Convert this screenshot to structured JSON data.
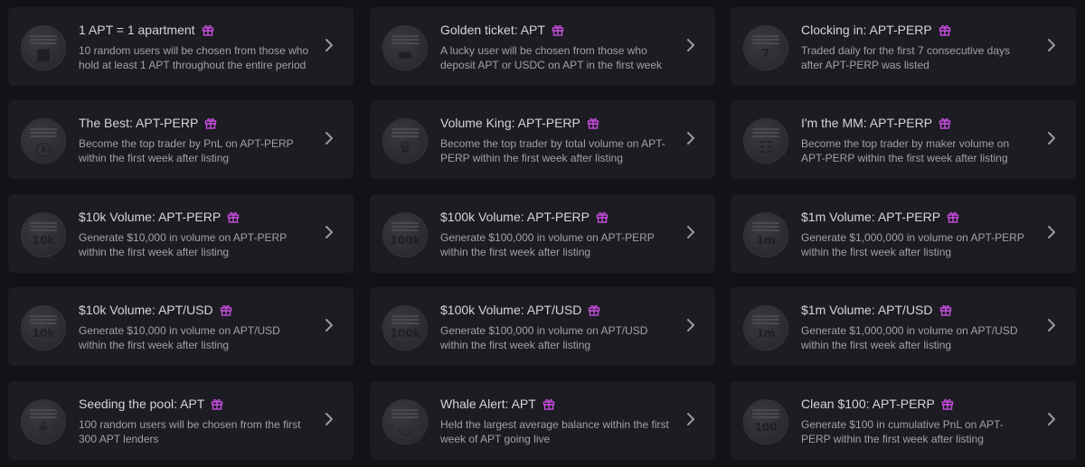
{
  "accent_color": "#c94ee0",
  "cards": [
    {
      "title": "1 APT = 1 apartment",
      "desc": "10 random users will be chosen from those who hold at least 1 APT throughout the entire period",
      "badge_icon": "person-icon",
      "badge_text": "■"
    },
    {
      "title": "Golden ticket: APT",
      "desc": "A lucky user will be chosen from those who deposit APT or USDC on APT in the first week",
      "badge_icon": "ticket-icon",
      "badge_text": "▬"
    },
    {
      "title": "Clocking in: APT-PERP",
      "desc": "Traded daily for the first 7 consecutive days after APT-PERP was listed",
      "badge_icon": "calendar-icon",
      "badge_text": "7"
    },
    {
      "title": "The Best: APT-PERP",
      "desc": "Become the top trader by PnL on APT-PERP within the first week after listing",
      "badge_icon": "rank-one-icon",
      "badge_text": "1"
    },
    {
      "title": "Volume King: APT-PERP",
      "desc": "Become the top trader by total volume on APT-PERP within the first week after listing",
      "badge_icon": "crown-icon",
      "badge_text": "♛"
    },
    {
      "title": "I'm the MM: APT-PERP",
      "desc": "Become the top trader by maker volume on APT-PERP within the first week after listing",
      "badge_icon": "orderbook-icon",
      "badge_text": "☷"
    },
    {
      "title": "$10k Volume: APT-PERP",
      "desc": "Generate $10,000 in volume on APT-PERP within the first week after listing",
      "badge_icon": "volume-10k-icon",
      "badge_text": "10k"
    },
    {
      "title": "$100k Volume: APT-PERP",
      "desc": "Generate $100,000 in volume on APT-PERP within the first week after listing",
      "badge_icon": "volume-100k-icon",
      "badge_text": "100k"
    },
    {
      "title": "$1m Volume: APT-PERP",
      "desc": "Generate $1,000,000 in volume on APT-PERP within the first week after listing",
      "badge_icon": "volume-1m-icon",
      "badge_text": "1m"
    },
    {
      "title": "$10k Volume: APT/USD",
      "desc": "Generate $10,000 in volume on APT/USD within the first week after listing",
      "badge_icon": "volume-10k-icon",
      "badge_text": "10k"
    },
    {
      "title": "$100k Volume: APT/USD",
      "desc": "Generate $100,000 in volume on APT/USD within the first week after listing",
      "badge_icon": "volume-100k-icon",
      "badge_text": "100k"
    },
    {
      "title": "$1m Volume: APT/USD",
      "desc": "Generate $1,000,000 in volume on APT/USD within the first week after listing",
      "badge_icon": "volume-1m-icon",
      "badge_text": "1m"
    },
    {
      "title": "Seeding the pool: APT",
      "desc": "100 random users will be chosen from the first 300 APT lenders",
      "badge_icon": "sprout-icon",
      "badge_text": "⚘"
    },
    {
      "title": "Whale Alert: APT",
      "desc": "Held the largest average balance within the first week of APT going live",
      "badge_icon": "whale-icon",
      "badge_text": "◡"
    },
    {
      "title": "Clean $100: APT-PERP",
      "desc": "Generate $100 in cumulative PnL on APT-PERP within the first week after listing",
      "badge_icon": "pnl-100-icon",
      "badge_text": "100"
    }
  ]
}
